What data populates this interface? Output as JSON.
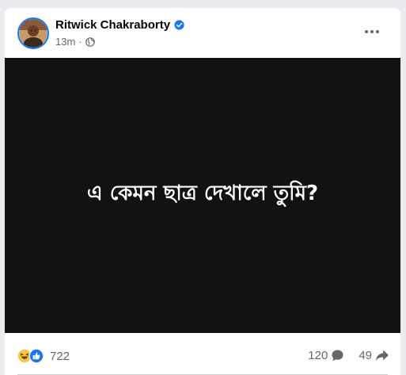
{
  "post": {
    "author": "Ritwick Chakraborty",
    "verified_icon": "verified-badge-icon",
    "time": "13m",
    "separator": "·",
    "audience_icon": "globe-icon",
    "more_icon": "more-horizontal-icon",
    "media_text": "এ কেমন ছাত্র দেখালে তুমি?"
  },
  "engagement": {
    "reaction_icons": [
      "haha-reaction-icon",
      "like-reaction-icon"
    ],
    "reaction_count": "722",
    "comments": "120",
    "comment_icon": "comment-icon",
    "shares": "49",
    "share_icon": "share-icon"
  },
  "colors": {
    "accent": "#1877f2",
    "media_background": "#121212",
    "secondary_text": "#65676b"
  }
}
